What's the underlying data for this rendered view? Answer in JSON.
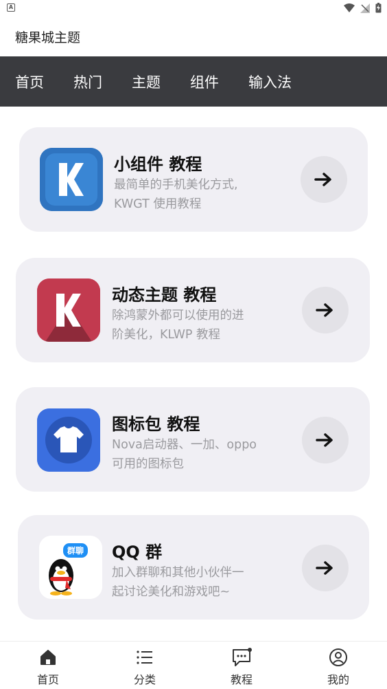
{
  "app": {
    "title": "糖果城主题"
  },
  "tabs": [
    {
      "label": "首页"
    },
    {
      "label": "热门"
    },
    {
      "label": "主题"
    },
    {
      "label": "组件"
    },
    {
      "label": "输入法"
    }
  ],
  "cards": [
    {
      "title": "小组件 教程",
      "desc_line1": "最简单的手机美化方式,",
      "desc_line2": "KWGT 使用教程",
      "icon": "kwgt-icon"
    },
    {
      "title": "动态主题 教程",
      "desc_line1": "除鸿蒙外都可以使用的进",
      "desc_line2": "阶美化，KLWP 教程",
      "icon": "klwp-icon"
    },
    {
      "title": "图标包 教程",
      "desc_line1": "Nova启动器、一加、oppo",
      "desc_line2": "可用的图标包",
      "icon": "icon-pack-icon"
    },
    {
      "title": "QQ 群",
      "desc_line1": "加入群聊和其他小伙伴一",
      "desc_line2": "起讨论美化和游戏吧~",
      "icon": "qq-icon",
      "badge": "群聊"
    }
  ],
  "bottom_nav": [
    {
      "label": "首页",
      "icon": "home-icon"
    },
    {
      "label": "分类",
      "icon": "list-icon"
    },
    {
      "label": "教程",
      "icon": "chat-icon"
    },
    {
      "label": "我的",
      "icon": "profile-icon"
    }
  ],
  "colors": {
    "tab_bar": "#3a3b3f",
    "card_bg": "#f0eff4",
    "kwgt_blue": "#2f74c0",
    "klwp_red": "#c23a4f",
    "icon_pack_blue": "#3b6fe0"
  }
}
